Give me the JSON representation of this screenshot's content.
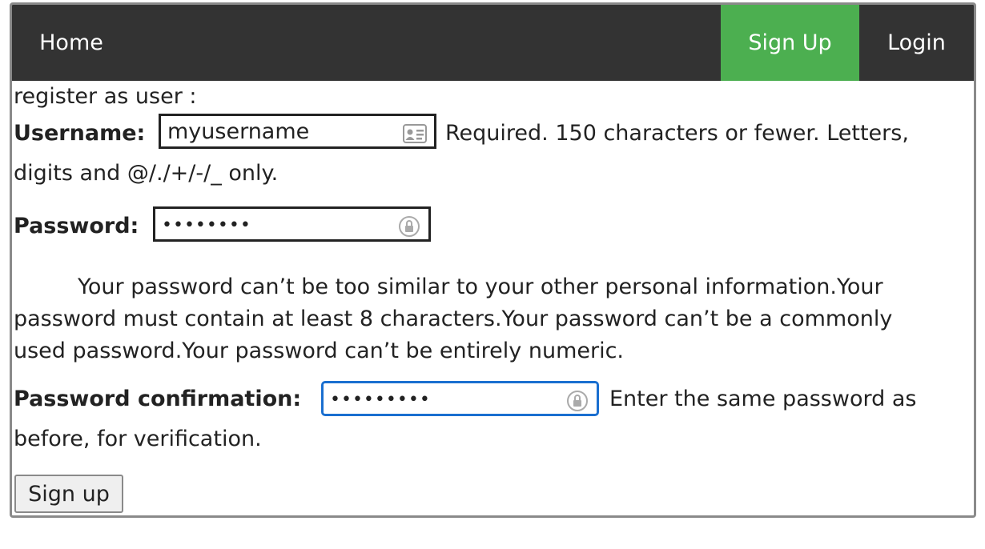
{
  "nav": {
    "home": "Home",
    "signup": "Sign Up",
    "login": "Login",
    "active_color": "#4caf50",
    "bar_color": "#333333"
  },
  "form": {
    "intro": "register as user :",
    "username_label": "Username:",
    "username_value": "myusername",
    "username_help_line1": "Required. 150 characters or fewer. Letters,",
    "username_help_line2": "digits and @/./+/-/_ only.",
    "password_label": "Password:",
    "password_value": "••••••••",
    "password_help_line1": "Your password can’t be too similar to your other personal information.Your",
    "password_help_line2": "password must contain at least 8 characters.Your password can’t be a commonly",
    "password_help_line3": "used password.Your password can’t be entirely numeric.",
    "confirm_label": "Password confirmation:",
    "confirm_value": "•••••••••",
    "confirm_help_line1": "Enter the same password as",
    "confirm_help_line2": "before, for verification.",
    "submit_label": "Sign up"
  }
}
